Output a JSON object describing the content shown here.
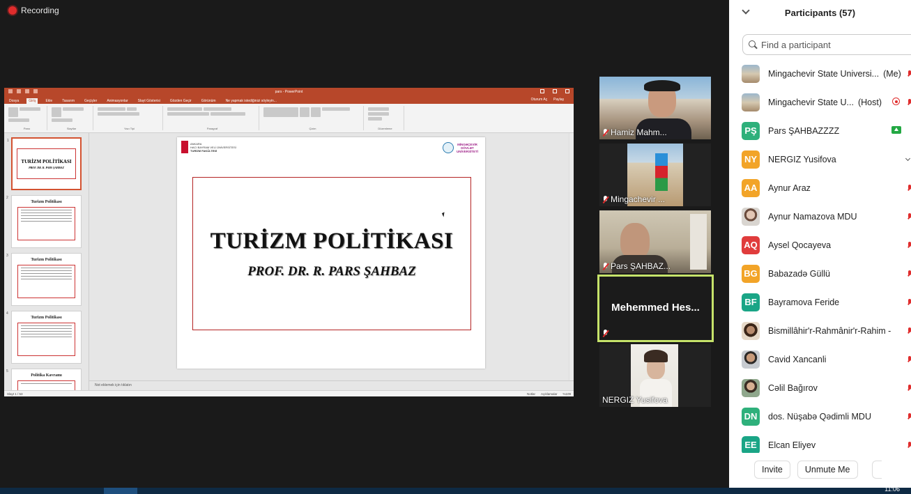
{
  "recording": {
    "label": "Recording"
  },
  "powerpoint": {
    "window_title": "pars - PowerPoint",
    "menu_tabs": [
      "Dosya",
      "Giriş",
      "Ekle",
      "Tasarım",
      "Geçişler",
      "Animasyonlar",
      "Slayt Gösterisi",
      "Gözden Geçir",
      "Görünüm"
    ],
    "tell_me": "Ne yapmak istediğinizi söyleyin...",
    "signin": "Oturum Aç",
    "share": "Paylaş",
    "ribbon_groups": [
      "Pano",
      "Slaytlar",
      "Yazı Tipi",
      "Paragraf",
      "Çizim",
      "Düzenleme"
    ],
    "thumb_titles": [
      "TURİZM POLİTİKASI",
      "Turizm Politikası",
      "Turizm Politikası",
      "Turizm Politikası",
      "Politika Kavramı"
    ],
    "slide": {
      "title": "TURİZM POLİTİKASI",
      "subtitle": "PROF. DR. R. PARS ŞAHBAZ",
      "logo_left": [
        "ANKARA",
        "HACI BAYRAM VELİ ÜNİVERSİTESİ",
        "TURİZM FAKÜLTESİ"
      ],
      "logo_right": [
        "MİNGƏÇEVİR",
        "DÖVLƏT",
        "UNİVERSİTETİ"
      ]
    },
    "notes_placeholder": "Not eklemek için tıklatın",
    "status_left": "Slayt 1 / 53",
    "status_notes": "Notlar",
    "status_comments": "Açıklamalar",
    "zoom": "%109"
  },
  "videos": [
    {
      "name": "Hamiz Mahm..."
    },
    {
      "name": "Mingachevir ..."
    },
    {
      "name": "Pars ŞAHBAZ..."
    },
    {
      "name": "Mehemmed Hes..."
    },
    {
      "name": "NERGIZ Yusifova"
    }
  ],
  "participants_panel": {
    "title": "Participants (57)",
    "search_placeholder": "Find a participant",
    "list": [
      {
        "initials": "",
        "name": "Mingachevir State Universi...",
        "tag": "(Me)",
        "color": ""
      },
      {
        "initials": "",
        "name": "Mingachevir State U...",
        "tag": "(Host)",
        "color": ""
      },
      {
        "initials": "PŞ",
        "name": "Pars ŞAHBAZZZZ",
        "tag": "",
        "color": "#2eb07b"
      },
      {
        "initials": "NY",
        "name": "NERGIZ Yusifova",
        "tag": "",
        "color": "#f2a428"
      },
      {
        "initials": "AA",
        "name": "Aynur Araz",
        "tag": "",
        "color": "#f2a428"
      },
      {
        "initials": "",
        "name": "Aynur Namazova MDU",
        "tag": "",
        "color": ""
      },
      {
        "initials": "AQ",
        "name": "Aysel Qocayeva",
        "tag": "",
        "color": "#e03c3c"
      },
      {
        "initials": "BG",
        "name": "Babazadə Güllü",
        "tag": "",
        "color": "#f2a428"
      },
      {
        "initials": "BF",
        "name": "Bayramova Feride",
        "tag": "",
        "color": "#1aa586"
      },
      {
        "initials": "",
        "name": "Bismillâhir'r-Rahmânir'r-Rahim -",
        "tag": "",
        "color": ""
      },
      {
        "initials": "",
        "name": "Cavid Xancanli",
        "tag": "",
        "color": ""
      },
      {
        "initials": "",
        "name": "Cəlil Bağırov",
        "tag": "",
        "color": ""
      },
      {
        "initials": "DN",
        "name": "dos. Nüşabə Qədimli MDU",
        "tag": "",
        "color": "#2eb07b"
      },
      {
        "initials": "EE",
        "name": "Elcan Eliyev",
        "tag": "",
        "color": "#1aa586"
      }
    ],
    "invite_label": "Invite",
    "unmute_label": "Unmute Me"
  },
  "taskbar": {
    "clock": "11:06"
  }
}
